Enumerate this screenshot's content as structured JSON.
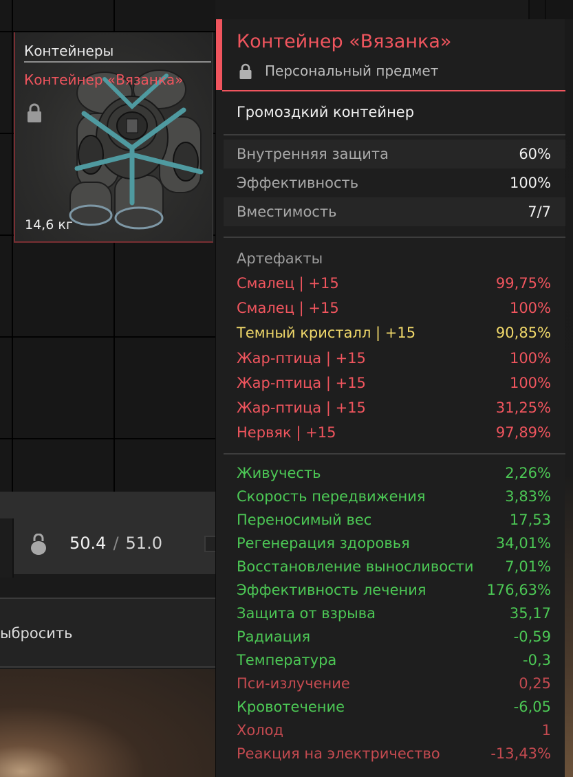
{
  "inventory": {
    "card": {
      "category": "Контейнеры",
      "name": "Контейнер «Вязанка»",
      "weight": "14,6 кг",
      "lock_icon": "lock-icon",
      "picture": "container-bundle-picture"
    },
    "carry_weight": {
      "icon": "kettlebell-icon",
      "current": "50.4",
      "separator": "/",
      "max": "51.0"
    },
    "drop_button_label": "ыбросить"
  },
  "tooltip": {
    "title": "Контейнер «Вязанка»",
    "subtitle": "Персональный предмет",
    "description": "Громоздкий контейнер",
    "stats": [
      {
        "label": "Внутренняя защита",
        "value": "60%"
      },
      {
        "label": "Эффективность",
        "value": "100%"
      },
      {
        "label": "Вместимость",
        "value": "7/7"
      }
    ],
    "artifacts_header": "Артефакты",
    "artifacts": [
      {
        "label": "Смалец | +15",
        "value": "99,75%",
        "color": "#f0555e"
      },
      {
        "label": "Смалец | +15",
        "value": "100%",
        "color": "#f0555e"
      },
      {
        "label": "Темный кристалл | +15",
        "value": "90,85%",
        "color": "#f0d86a"
      },
      {
        "label": "Жар-птица | +15",
        "value": "100%",
        "color": "#f0555e"
      },
      {
        "label": "Жар-птица | +15",
        "value": "100%",
        "color": "#f0555e"
      },
      {
        "label": "Жар-птица | +15",
        "value": "31,25%",
        "color": "#f0555e"
      },
      {
        "label": "Нервяк | +15",
        "value": "97,89%",
        "color": "#f0555e"
      }
    ],
    "effects": [
      {
        "label": "Живучесть",
        "value": "2,26%",
        "color": "#4cc855"
      },
      {
        "label": "Скорость передвижения",
        "value": "3,83%",
        "color": "#4cc855"
      },
      {
        "label": "Переносимый вес",
        "value": "17,53",
        "color": "#4cc855"
      },
      {
        "label": "Регенерация здоровья",
        "value": "34,01%",
        "color": "#4cc855"
      },
      {
        "label": "Восстановление выносливости",
        "value": "7,01%",
        "color": "#4cc855"
      },
      {
        "label": "Эффективность лечения",
        "value": "176,63%",
        "color": "#4cc855"
      },
      {
        "label": "Защита от взрыва",
        "value": "35,17",
        "color": "#4cc855"
      },
      {
        "label": "Радиация",
        "value": "-0,59",
        "color": "#4cc855"
      },
      {
        "label": "Температура",
        "value": "-0,3",
        "color": "#4cc855"
      },
      {
        "label": "Пси-излучение",
        "value": "0,25",
        "color": "#c44a50"
      },
      {
        "label": "Кровотечение",
        "value": "-6,05",
        "color": "#4cc855"
      },
      {
        "label": "Холод",
        "value": "1",
        "color": "#c44a50"
      },
      {
        "label": "Реакция на электричество",
        "value": "-13,43%",
        "color": "#c44a50"
      }
    ]
  }
}
